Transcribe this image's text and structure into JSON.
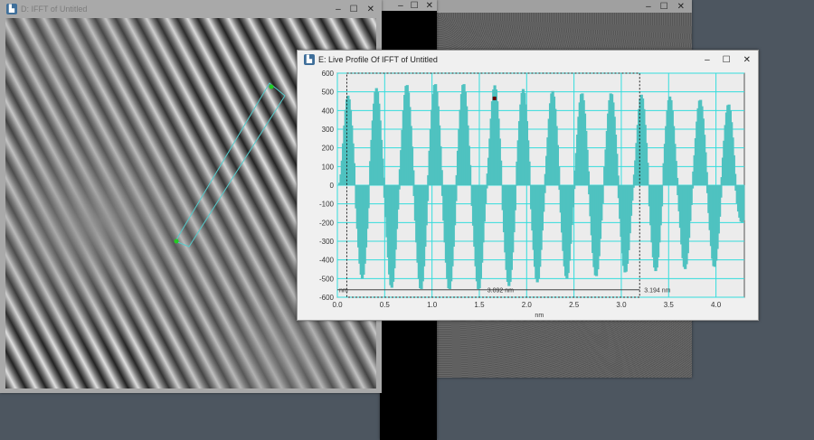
{
  "windows": {
    "d": {
      "title": "D: IFFT of Untitled"
    },
    "e": {
      "title": "E: Live Profile Of IFFT of Untitled"
    },
    "controls": {
      "minimize": "–",
      "maximize": "☐",
      "close": "✕"
    },
    "icon": "app-icon"
  },
  "chart_data": {
    "type": "bar",
    "title": "",
    "xlabel": "nm",
    "ylabel": "",
    "xlim": [
      0,
      4.3
    ],
    "ylim": [
      -600,
      600
    ],
    "xticks": [
      "0.0",
      "0.5",
      "1.0",
      "1.5",
      "2.0",
      "2.5",
      "3.0",
      "3.5",
      "4.0"
    ],
    "yticks": [
      "600",
      "500",
      "400",
      "300",
      "200",
      "100",
      "0",
      "-100",
      "-200",
      "-300",
      "-400",
      "-500",
      "-600"
    ],
    "grid": true,
    "peaks_x": [
      0.1,
      0.4,
      0.72,
      1.02,
      1.32,
      1.65,
      1.95,
      2.26,
      2.57,
      2.88,
      3.2,
      3.5,
      3.82,
      4.12
    ],
    "peaks_y": [
      480,
      520,
      540,
      545,
      545,
      535,
      515,
      505,
      495,
      495,
      485,
      475,
      460,
      435
    ],
    "troughs_x": [
      0.25,
      0.56,
      0.87,
      1.17,
      1.48,
      1.8,
      2.1,
      2.41,
      2.72,
      3.03,
      3.35,
      3.66,
      3.97,
      4.26
    ],
    "troughs_y": [
      -500,
      -550,
      -560,
      -560,
      -560,
      -540,
      -520,
      -500,
      -490,
      -470,
      -460,
      -450,
      -440,
      -200
    ],
    "marker": {
      "x": 1.66,
      "y": 465
    },
    "selection": {
      "start": 0.1,
      "end": 3.194
    },
    "annotations": {
      "left": "nm",
      "width": "3.092 nm",
      "end": "3.194 nm"
    }
  }
}
